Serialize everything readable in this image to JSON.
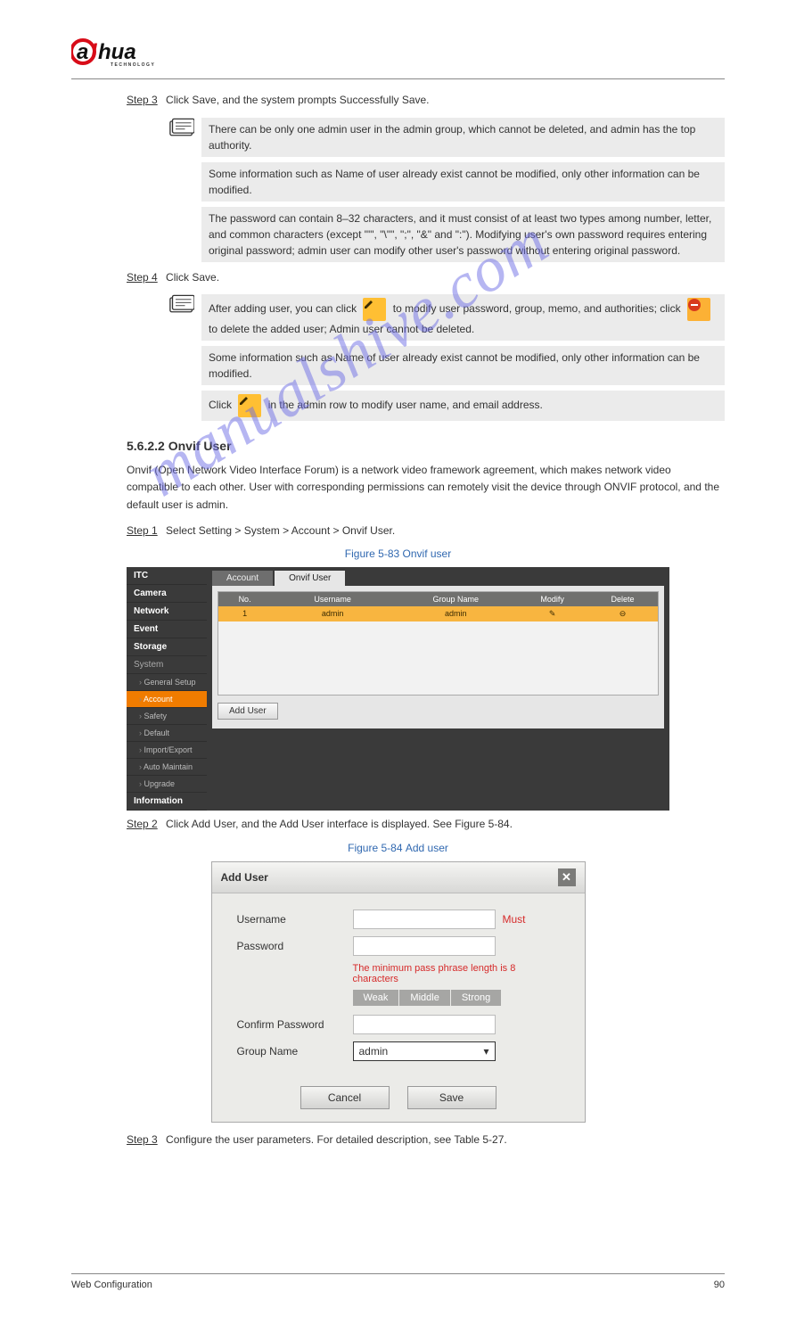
{
  "logo": {
    "brand_left": "a",
    "brand_slash": "l",
    "brand_right": "hua",
    "tech": "TECHNOLOGY"
  },
  "step3": {
    "label": "Step 3",
    "text": "Click Save, and the system prompts Successfully Save.",
    "notes": [
      "There can be only one admin user in the admin group, which cannot be deleted, and admin has the top authority.",
      "Some information such as Name of user already exist cannot be modified, only other information can be modified.",
      "The password can contain 8–32 characters, and it must consist of at least two types among number, letter, and common characters (except \"'\", \"\\\"\", \";\", \"&\" and \":\"). Modifying user's own password requires entering original password; admin user can modify other user's password without entering original password."
    ]
  },
  "step4": {
    "label": "Step 4",
    "text": "Click Save.",
    "notes": [
      {
        "pre": "After adding user, you can click ",
        "mid": " to modify user password, group, memo, and authorities; click ",
        "after": " to delete the added user; Admin user cannot be deleted."
      },
      {
        "text": "Some information such as Name of user already exist cannot be modified, only other information can be modified."
      },
      {
        "pre": "Click ",
        "after": " in the admin row to modify user name, and email address."
      }
    ]
  },
  "section": {
    "num": "5.6.2.2",
    "title": "Onvif User"
  },
  "onvif_intro": "Onvif (Open Network Video Interface Forum) is a network video framework agreement, which makes network video compatible to each other. User with corresponding permissions can remotely visit the device through ONVIF protocol, and the default user is admin.",
  "step1": {
    "label": "Step 1",
    "text": "Select Setting > System > Account > Onvif User."
  },
  "fig83": {
    "label": "Figure 5-83",
    "title": "Onvif user"
  },
  "shot1": {
    "side_top": [
      "ITC",
      "Camera",
      "Network",
      "Event",
      "Storage"
    ],
    "side_system": "System",
    "side_sub": [
      "General Setup",
      "Account",
      "Safety",
      "Default",
      "Import/Export",
      "Auto Maintain",
      "Upgrade"
    ],
    "side_bottom": "Information",
    "tab1": "Account",
    "tab2": "Onvif User",
    "th": [
      "No.",
      "Username",
      "Group Name",
      "Modify",
      "Delete"
    ],
    "row": [
      "1",
      "admin",
      "admin",
      "✎",
      "⊖"
    ],
    "adduser": "Add User"
  },
  "step2": {
    "label": "Step 2",
    "text": "Click Add User, and the Add User interface is displayed. See Figure 5-84."
  },
  "fig84": {
    "label": "Figure 5-84",
    "title": "Add user"
  },
  "dlg": {
    "title": "Add User",
    "username": "Username",
    "must": "Must",
    "password": "Password",
    "hint": "The minimum pass phrase length is 8 characters",
    "weak": "Weak",
    "middle": "Middle",
    "strong": "Strong",
    "confirm": "Confirm Password",
    "group": "Group Name",
    "group_val": "admin",
    "cancel": "Cancel",
    "save": "Save"
  },
  "stepC": {
    "label": "Step 3",
    "text": "Configure the user parameters. For detailed description, see Table 5-27."
  },
  "footer": {
    "left": "Web Configuration",
    "right": "90"
  },
  "watermark": "manualshive.com"
}
